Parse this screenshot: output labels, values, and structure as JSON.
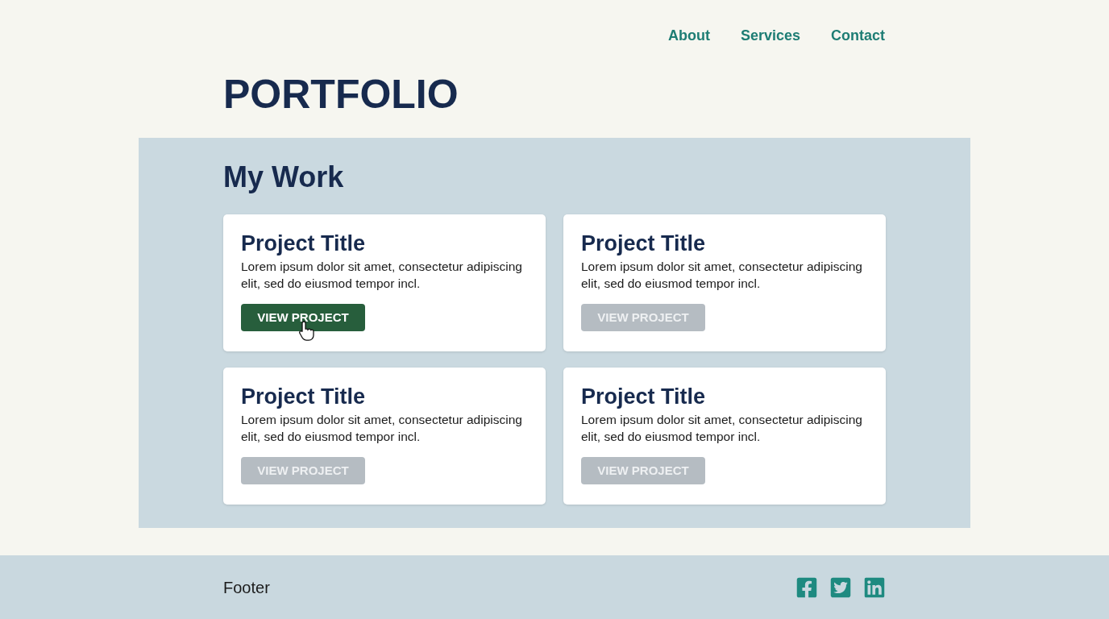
{
  "nav": {
    "links": [
      "About",
      "Services",
      "Contact"
    ]
  },
  "header": {
    "title": "PORTFOLIO"
  },
  "section": {
    "heading": "My Work",
    "projects": [
      {
        "title": "Project Title",
        "description": "Lorem ipsum dolor sit amet, consectetur adipiscing elit, sed do eiusmod tempor incl.",
        "button": "VIEW PROJECT",
        "active": true
      },
      {
        "title": "Project Title",
        "description": "Lorem ipsum dolor sit amet, consectetur adipiscing elit, sed do eiusmod tempor incl.",
        "button": "VIEW PROJECT",
        "active": false
      },
      {
        "title": "Project Title",
        "description": "Lorem ipsum dolor sit amet, consectetur adipiscing elit, sed do eiusmod tempor incl.",
        "button": "VIEW PROJECT",
        "active": false
      },
      {
        "title": "Project Title",
        "description": "Lorem ipsum dolor sit amet, consectetur adipiscing elit, sed do eiusmod tempor incl.",
        "button": "VIEW PROJECT",
        "active": false
      }
    ]
  },
  "footer": {
    "text": "Footer"
  }
}
